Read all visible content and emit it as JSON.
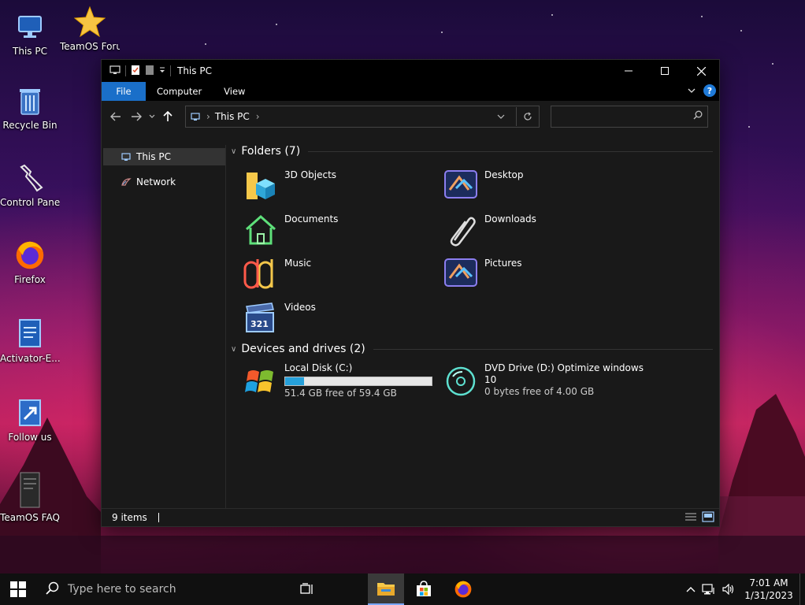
{
  "desktop": {
    "icons": [
      {
        "label": "This PC"
      },
      {
        "label": "TeamOS Forum H"
      },
      {
        "label": "Recycle Bin"
      },
      {
        "label": "Control Panel"
      },
      {
        "label": "Firefox"
      },
      {
        "label": "Activator-E..."
      },
      {
        "label": "Follow us"
      },
      {
        "label": "TeamOS FAQ"
      }
    ]
  },
  "window": {
    "title": "This PC",
    "tabs": {
      "file": "File",
      "computer": "Computer",
      "view": "View"
    },
    "help_label": "?",
    "address": {
      "crumb": "This PC"
    },
    "search": {
      "placeholder": ""
    },
    "sidebar": {
      "items": [
        {
          "label": "This PC"
        },
        {
          "label": "Network"
        }
      ]
    },
    "folders_header": "Folders (7)",
    "folders": [
      {
        "name": "3D Objects"
      },
      {
        "name": "Desktop"
      },
      {
        "name": "Documents"
      },
      {
        "name": "Downloads"
      },
      {
        "name": "Music"
      },
      {
        "name": "Pictures"
      },
      {
        "name": "Videos"
      }
    ],
    "drives_header": "Devices and drives (2)",
    "drives": [
      {
        "name": "Local Disk (C:)",
        "free": "51.4 GB free of 59.4 GB",
        "used_fraction": 0.13
      },
      {
        "name": "DVD Drive (D:) Optimize windows",
        "name2": "10",
        "free": "0 bytes free of 4.00 GB"
      }
    ],
    "status": {
      "count": "9 items"
    }
  },
  "taskbar": {
    "search_placeholder": "Type here to search",
    "time": "7:01 AM",
    "date": "1/31/2023"
  },
  "colors": {
    "accent": "#1a6fc9",
    "drive_bar": "#26a0da"
  }
}
